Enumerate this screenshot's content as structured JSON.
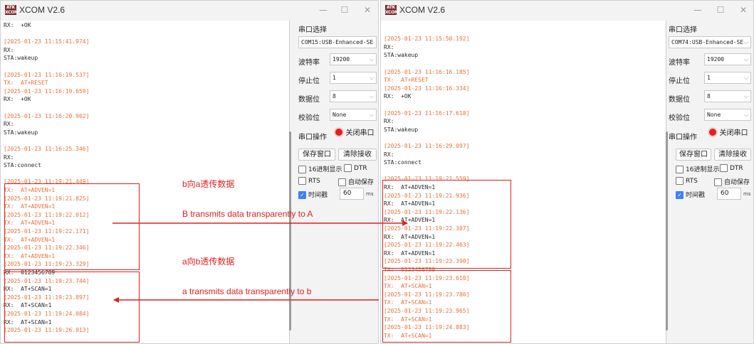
{
  "left_window": {
    "title": "XCOM V2.6",
    "icon_text": "ATK XCOM",
    "terminal_lines": [
      {
        "k": "rx",
        "t": "RX:  +OK"
      },
      {
        "k": "blank",
        "t": ""
      },
      {
        "k": "time",
        "t": "[2025-01-23 11:15:41.974]"
      },
      {
        "k": "rx",
        "t": "RX:"
      },
      {
        "k": "rx",
        "t": "STA:wakeup"
      },
      {
        "k": "blank",
        "t": ""
      },
      {
        "k": "time",
        "t": "[2025-01-23 11:16:19.537]"
      },
      {
        "k": "tx",
        "t": "TX:  AT+RESET"
      },
      {
        "k": "time",
        "t": "[2025-01-23 11:16:19.659]"
      },
      {
        "k": "rx",
        "t": "RX:  +OK"
      },
      {
        "k": "blank",
        "t": ""
      },
      {
        "k": "time",
        "t": "[2025-01-23 11:16:20.902]"
      },
      {
        "k": "rx",
        "t": "RX:"
      },
      {
        "k": "rx",
        "t": "STA:wakeup"
      },
      {
        "k": "blank",
        "t": ""
      },
      {
        "k": "time",
        "t": "[2025-01-23 11:16:25.346]"
      },
      {
        "k": "rx",
        "t": "RX:"
      },
      {
        "k": "rx",
        "t": "STA:connect"
      },
      {
        "k": "blank",
        "t": ""
      },
      {
        "k": "time",
        "t": "[2025-01-23 11:19:21.449]"
      },
      {
        "k": "tx",
        "t": "TX:  AT+ADVEN=1"
      },
      {
        "k": "time",
        "t": "[2025-01-23 11:19:21.825]"
      },
      {
        "k": "tx",
        "t": "TX:  AT+ADVEN=1"
      },
      {
        "k": "time",
        "t": "[2025-01-23 11:19:22.012]"
      },
      {
        "k": "tx",
        "t": "TX:  AT+ADVEN=1"
      },
      {
        "k": "time",
        "t": "[2025-01-23 11:19:22.171]"
      },
      {
        "k": "tx",
        "t": "TX:  AT+ADVEN=1"
      },
      {
        "k": "time",
        "t": "[2025-01-23 11:19:22.346]"
      },
      {
        "k": "tx",
        "t": "TX:  AT+ADVEN=1"
      },
      {
        "k": "time",
        "t": "[2025-01-23 11:19:23.329]"
      },
      {
        "k": "rx",
        "t": "RX:  0123456789"
      },
      {
        "k": "time",
        "t": "[2025-01-23 11:19:23.744]"
      },
      {
        "k": "rx",
        "t": "RX:  AT+SCAN=1"
      },
      {
        "k": "time",
        "t": "[2025-01-23 11:19:23.897]"
      },
      {
        "k": "rx",
        "t": "RX:  AT+SCAN=1"
      },
      {
        "k": "time",
        "t": "[2025-01-23 11:19:24.084]"
      },
      {
        "k": "rx",
        "t": "RX:  AT+SCAN=1"
      },
      {
        "k": "time",
        "t": "[2025-01-23 11:19:26.013]"
      }
    ],
    "panel": {
      "port_select_label": "串口选择",
      "port_value": "COM15:USB-Enhanced-SE",
      "baud_label": "波特率",
      "baud_value": "19200",
      "stopbits_label": "停止位",
      "stopbits_value": "1",
      "databits_label": "数据位",
      "databits_value": "8",
      "parity_label": "校验位",
      "parity_value": "None",
      "port_op_label": "串口操作",
      "close_port_button": "关闭串口",
      "save_window_button": "保存窗口",
      "clear_receive_button": "清除接收",
      "hex_display_label": "16进制显示",
      "dtr_label": "DTR",
      "rts_label": "RTS",
      "auto_save_label": "自动保存",
      "timestamp_label": "时间戳",
      "timestamp_value": "60",
      "timestamp_unit": "ms"
    }
  },
  "right_window": {
    "title": "XCOM V2.6",
    "icon_text": "ATK XCOM",
    "terminal_lines": [
      {
        "k": "blank",
        "t": ""
      },
      {
        "k": "blank",
        "t": ""
      },
      {
        "k": "time",
        "t": "[2025-01-23 11:15:50.192]"
      },
      {
        "k": "rx",
        "t": "RX:"
      },
      {
        "k": "rx",
        "t": "STA:wakeup"
      },
      {
        "k": "blank",
        "t": ""
      },
      {
        "k": "time",
        "t": "[2025-01-23 11:16:16.185]"
      },
      {
        "k": "tx",
        "t": "TX:  AT+RESET"
      },
      {
        "k": "time",
        "t": "[2025-01-23 11:16:16.334]"
      },
      {
        "k": "rx",
        "t": "RX:  +OK"
      },
      {
        "k": "blank",
        "t": ""
      },
      {
        "k": "time",
        "t": "[2025-01-23 11:16:17.618]"
      },
      {
        "k": "rx",
        "t": "RX:"
      },
      {
        "k": "rx",
        "t": "STA:wakeup"
      },
      {
        "k": "blank",
        "t": ""
      },
      {
        "k": "time",
        "t": "[2025-01-23 11:16:29.097]"
      },
      {
        "k": "rx",
        "t": "RX:"
      },
      {
        "k": "rx",
        "t": "STA:connect"
      },
      {
        "k": "blank",
        "t": ""
      },
      {
        "k": "time",
        "t": "[2025-01-23 11:19:21.559]"
      },
      {
        "k": "rx",
        "t": "RX:  AT+ADVEN=1"
      },
      {
        "k": "time",
        "t": "[2025-01-23 11:19:21.936]"
      },
      {
        "k": "rx",
        "t": "RX:  AT+ADVEN=1"
      },
      {
        "k": "time",
        "t": "[2025-01-23 11:19:22.136]"
      },
      {
        "k": "rx",
        "t": "RX:  AT+ADVEN=1"
      },
      {
        "k": "time",
        "t": "[2025-01-23 11:19:22.307]"
      },
      {
        "k": "rx",
        "t": "RX:  AT+ADVEN=1"
      },
      {
        "k": "time",
        "t": "[2025-01-23 11:19:22.463]"
      },
      {
        "k": "rx",
        "t": "RX:  AT+ADVEN=1"
      },
      {
        "k": "time",
        "t": "[2025-01-23 11:19:23.390]"
      },
      {
        "k": "tx",
        "t": "TX:  0123456789"
      },
      {
        "k": "time",
        "t": "[2025-01-23 11:19:23.610]"
      },
      {
        "k": "tx",
        "t": "TX:  AT+SCAN=1"
      },
      {
        "k": "time",
        "t": "[2025-01-23 11:19:23.780]"
      },
      {
        "k": "tx",
        "t": "TX:  AT+SCAN=1"
      },
      {
        "k": "time",
        "t": "[2025-01-23 11:19:23.965]"
      },
      {
        "k": "tx",
        "t": "TX:  AT+SCAN=1"
      },
      {
        "k": "time",
        "t": "[2025-01-23 11:19:24.883]"
      },
      {
        "k": "tx",
        "t": "TX:  AT+SCAN=1"
      }
    ],
    "panel": {
      "port_select_label": "串口选择",
      "port_value": "COM74:USB-Enhanced-SE",
      "baud_label": "波特率",
      "baud_value": "19200",
      "stopbits_label": "停止位",
      "stopbits_value": "1",
      "databits_label": "数据位",
      "databits_value": "8",
      "parity_label": "校验位",
      "parity_value": "None",
      "port_op_label": "串口操作",
      "close_port_button": "关闭串口",
      "save_window_button": "保存窗口",
      "clear_receive_button": "清除接收",
      "hex_display_label": "16进制显示",
      "dtr_label": "DTR",
      "rts_label": "RTS",
      "auto_save_label": "自动保存",
      "timestamp_label": "时间戳",
      "timestamp_value": "60",
      "timestamp_unit": "ms"
    }
  },
  "annotations": {
    "b_to_a_cn": "b向a透传数据",
    "b_to_a_en": "B transmits data transparently to A",
    "a_to_b_cn": "a向b透传数据",
    "a_to_b_en": "a transmits data transparently to b",
    "color": "#e02020"
  },
  "colors": {
    "timestamp": "#e8703a",
    "rx_text": "#2a2a2a",
    "highlight_box": "#e02020",
    "checkbox_on": "#3b82f6"
  }
}
